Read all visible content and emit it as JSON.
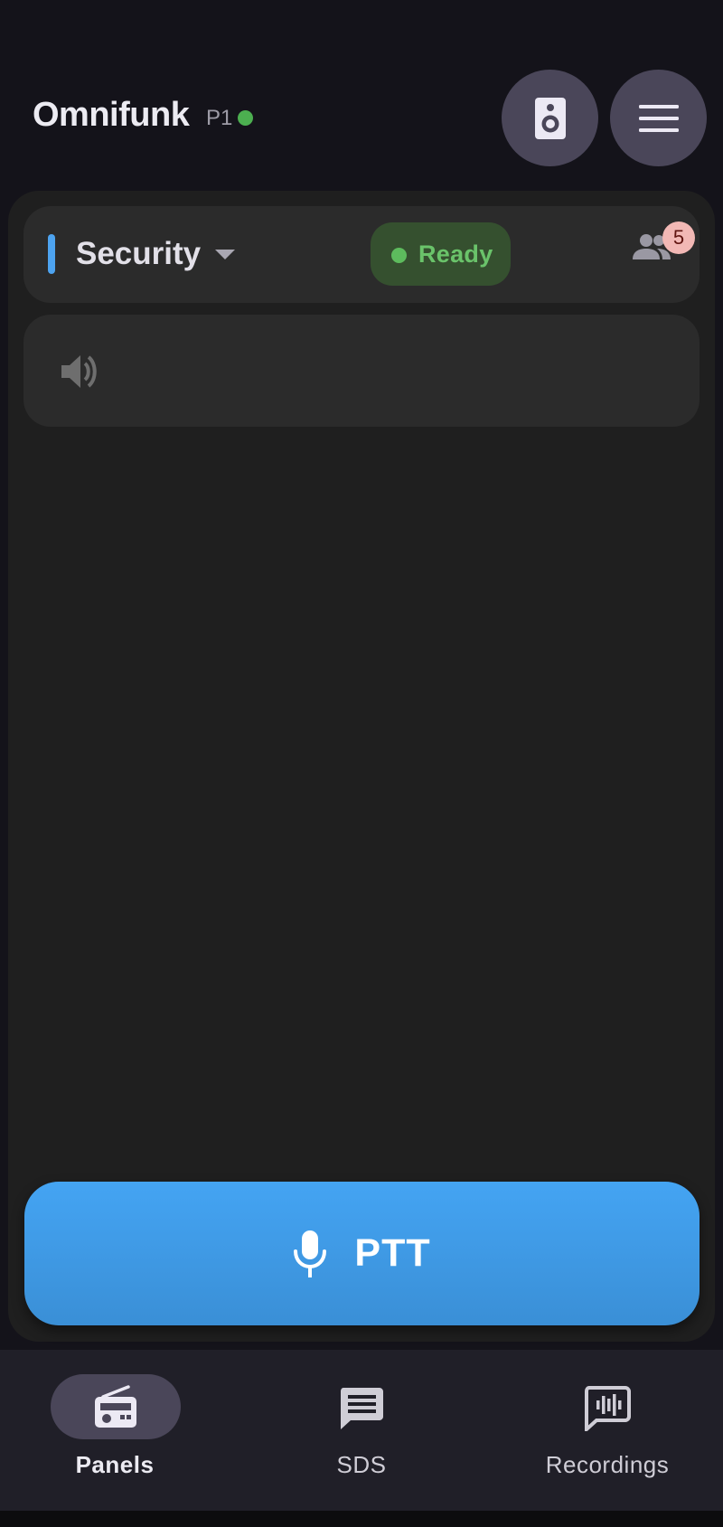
{
  "header": {
    "title": "Omnifunk",
    "profile": "P1",
    "online_color": "#4caf50",
    "speaker_button_icon": "speaker-icon",
    "menu_button_icon": "menu-icon"
  },
  "channel": {
    "name": "Security",
    "accent_color": "#4da3f0",
    "status": "Ready",
    "status_color": "#6ac36a",
    "members_icon": "group-icon",
    "member_count": "5"
  },
  "audio": {
    "icon": "volume-icon"
  },
  "ptt": {
    "label": "PTT",
    "icon": "microphone-icon",
    "color": "#44a4f3"
  },
  "nav": {
    "items": [
      {
        "label": "Panels",
        "icon": "radio-icon",
        "active": true
      },
      {
        "label": "SDS",
        "icon": "message-icon",
        "active": false
      },
      {
        "label": "Recordings",
        "icon": "voice-chat-icon",
        "active": false
      }
    ]
  }
}
